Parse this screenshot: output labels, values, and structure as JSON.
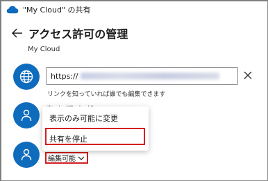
{
  "window": {
    "title": "\"My Cloud\" の共有"
  },
  "header": {
    "title": "アクセス許可の管理",
    "subtitle": "My Cloud"
  },
  "link": {
    "url_prefix": "https://",
    "note": "リンクを知っていれば誰でも編集できます"
  },
  "person1": {
    "name": "宮 上 理 士 部"
  },
  "menu": {
    "items": [
      {
        "label": "表示のみ可能に変更"
      },
      {
        "label": "共有を停止"
      }
    ]
  },
  "person2": {
    "permission": "編集可能"
  },
  "colors": {
    "accent": "#0f6cbd",
    "highlight": "#d21f1f"
  }
}
